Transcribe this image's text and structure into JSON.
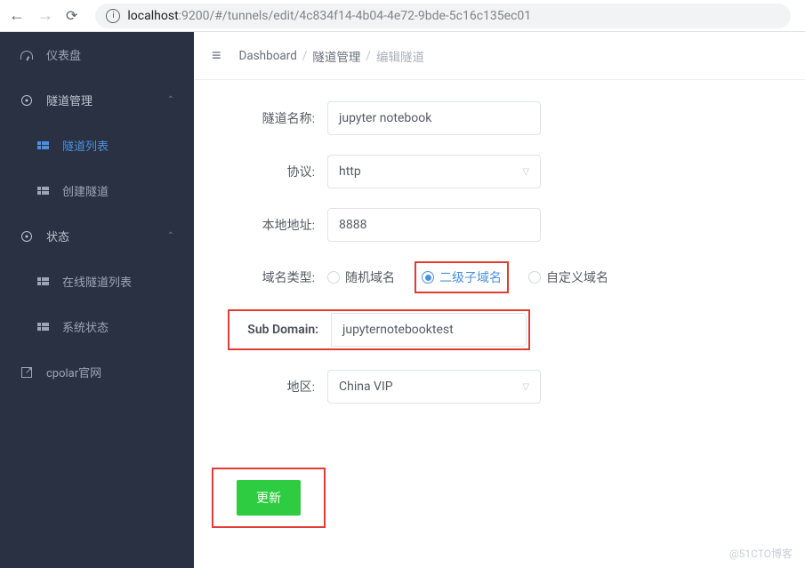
{
  "browser": {
    "url_host": "localhost",
    "url_port_path": ":9200/#/tunnels/edit/4c834f14-4b04-4e72-9bde-5c16c135ec01"
  },
  "sidebar": {
    "dashboard": "仪表盘",
    "tunnel_mgmt": "隧道管理",
    "tunnel_list": "隧道列表",
    "create_tunnel": "创建隧道",
    "status": "状态",
    "online_list": "在线隧道列表",
    "system_status": "系统状态",
    "cpolar_site": "cpolar官网"
  },
  "breadcrumb": {
    "dashboard": "Dashboard",
    "tunnel_mgmt": "隧道管理",
    "edit_tunnel": "编辑隧道"
  },
  "form": {
    "name_label": "隧道名称:",
    "name_value": "jupyter notebook",
    "protocol_label": "协议:",
    "protocol_value": "http",
    "local_addr_label": "本地地址:",
    "local_addr_value": "8888",
    "domain_type_label": "域名类型:",
    "radio_random": "随机域名",
    "radio_sub": "二级子域名",
    "radio_custom": "自定义域名",
    "subdomain_label": "Sub Domain:",
    "subdomain_value": "jupyternotebooktest",
    "region_label": "地区:",
    "region_value": "China VIP",
    "update_btn": "更新"
  },
  "watermark": "@51CTO博客"
}
